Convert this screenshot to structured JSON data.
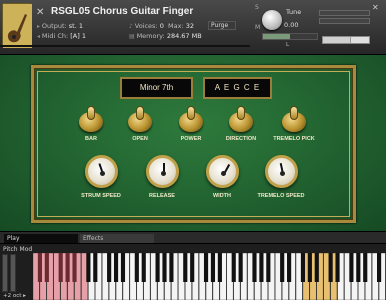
{
  "header": {
    "instrument_name": "RSGL05 Chorus Guitar Finger",
    "close_glyph": "✕",
    "output_label": "Output:",
    "output_value": "st. 1",
    "midi_label": "Midi Ch:",
    "midi_value": "[A] 1",
    "voices_label": "Voices:",
    "voices_value": "0",
    "max_label": "Max:",
    "max_value": "32",
    "purge_label": "Purge",
    "memory_label": "Memory:",
    "memory_value": "284.67 MB",
    "tune_label": "Tune",
    "tune_value": "0.00",
    "s_label": "S",
    "m_label": "M",
    "pan_label": "L",
    "pan_value": 0.5
  },
  "panel": {
    "chord": "Minor 7th",
    "notes": "A E G C E",
    "toggles": [
      {
        "label": "BAR"
      },
      {
        "label": "OPEN"
      },
      {
        "label": "POWER"
      },
      {
        "label": "DIRECTION"
      },
      {
        "label": "TREMELO PICK"
      }
    ],
    "gauges": [
      {
        "label": "STRUM SPEED",
        "value": 0.42
      },
      {
        "label": "RELEASE",
        "value": 0.5
      },
      {
        "label": "WIDTH",
        "value": 0.62
      },
      {
        "label": "TREMELO SPEED",
        "value": 0.45
      }
    ]
  },
  "statusbar": {
    "play_tab": "Play",
    "effects_tab": "Effects"
  },
  "keyboard": {
    "pitch_mod_label": "Pitch Mod",
    "octave_label": "+2 oct ▸",
    "keyswitch_color": "#e8a0a8",
    "active_color": "#e8c070"
  },
  "colors": {
    "panel_green": "#236632",
    "frame_gold": "#a88a3e",
    "display_text": "#f2e6c4"
  }
}
